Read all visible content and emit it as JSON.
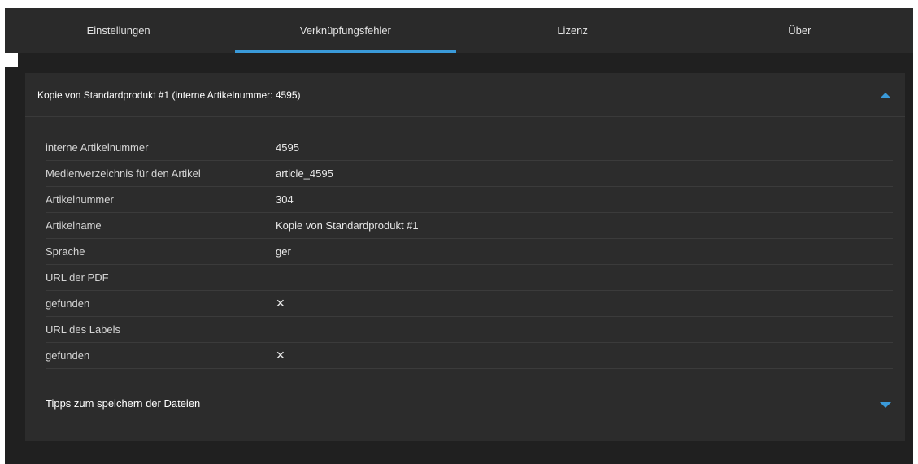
{
  "tabs": [
    {
      "label": "Einstellungen",
      "active": false
    },
    {
      "label": "Verknüpfungsfehler",
      "active": true
    },
    {
      "label": "Lizenz",
      "active": false
    },
    {
      "label": "Über",
      "active": false
    }
  ],
  "panel": {
    "title": "Kopie von Standardprodukt #1 (interne Artikelnummer: 4595)",
    "expanded": true
  },
  "details": [
    {
      "key": "interne Artikelnummer",
      "value": "4595"
    },
    {
      "key": "Medienverzeichnis für den Artikel",
      "value": "article_4595"
    },
    {
      "key": "Artikelnummer",
      "value": "304"
    },
    {
      "key": "Artikelname",
      "value": "Kopie von Standardprodukt #1"
    },
    {
      "key": "Sprache",
      "value": "ger"
    },
    {
      "key": "URL der PDF",
      "value": ""
    },
    {
      "key": "gefunden",
      "value": "✕",
      "status": "error"
    },
    {
      "key": "URL des Labels",
      "value": ""
    },
    {
      "key": "gefunden",
      "value": "✕",
      "status": "error"
    }
  ],
  "tips": {
    "label": "Tipps zum speichern der Dateien",
    "expanded": false
  },
  "colors": {
    "accent": "#3a9ad9",
    "error": "#d0232a",
    "background": "#202020",
    "panel": "#2c2c2c"
  },
  "icons": {
    "collapse": "chevron-up-icon",
    "expand": "chevron-down-icon",
    "not_found": "close-icon"
  }
}
